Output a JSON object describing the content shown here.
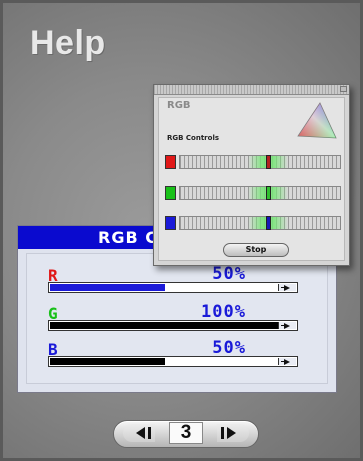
{
  "page": {
    "title": "Help"
  },
  "main_panel": {
    "header": "RGB C",
    "channels": [
      {
        "label": "R",
        "value_text": "50%",
        "fraction": 0.5,
        "label_color": "#e01818",
        "fill_color": "#1a1ad8"
      },
      {
        "label": "G",
        "value_text": "100%",
        "fraction": 1.0,
        "label_color": "#18c018",
        "fill_color": "#000000"
      },
      {
        "label": "B",
        "value_text": "50%",
        "fraction": 0.5,
        "label_color": "#1a1ad8",
        "fill_color": "#000000"
      }
    ]
  },
  "rgb_popup": {
    "name": "RGB",
    "subtitle": "RGB Controls",
    "icon": "color-triangle-icon",
    "sliders": [
      {
        "color": "#e01818",
        "marker_color": "#b32020",
        "level": 0.55
      },
      {
        "color": "#18c018",
        "marker_color": "#2fc02f",
        "level": 0.55
      },
      {
        "color": "#1a1ad8",
        "marker_color": "#1818b8",
        "level": 0.55
      }
    ],
    "stop_label": "Stop"
  },
  "pager": {
    "current": "3",
    "prev_icon": "arrow-left-icon",
    "next_icon": "arrow-right-icon"
  }
}
